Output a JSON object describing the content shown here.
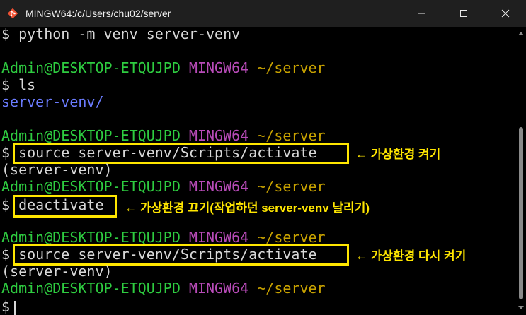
{
  "window": {
    "title": "MINGW64:/c/Users/chu02/server",
    "icon": "git-bash-icon",
    "controls": {
      "minimize": "minimize-icon",
      "maximize": "maximize-icon",
      "close": "close-icon"
    }
  },
  "colors": {
    "user": "#2ecc40",
    "mingw": "#b84bb8",
    "path": "#c8a200",
    "directory": "#6b7cff",
    "highlight": "#ffe600",
    "text": "#d8d8d8",
    "background": "#000000"
  },
  "prompt": {
    "user": "Admin@DESKTOP-ETQUJPD",
    "system": "MINGW64",
    "cwd": "~/server",
    "symbol": "$"
  },
  "terminal": {
    "cmd1": "python -m venv server-venv",
    "cmd2": "ls",
    "ls_output": "server-venv/",
    "cmd3": "source server-venv/Scripts/activate",
    "venv_label": "(server-venv)",
    "cmd4": "deactivate",
    "cmd5": "source server-venv/Scripts/activate"
  },
  "annotations": {
    "activate": "← 가상환경 켜기",
    "deactivate": "← 가상환경 끄기(작업하던 server-venv 날리기)",
    "reactivate": "← 가상환경 다시 켜기"
  }
}
